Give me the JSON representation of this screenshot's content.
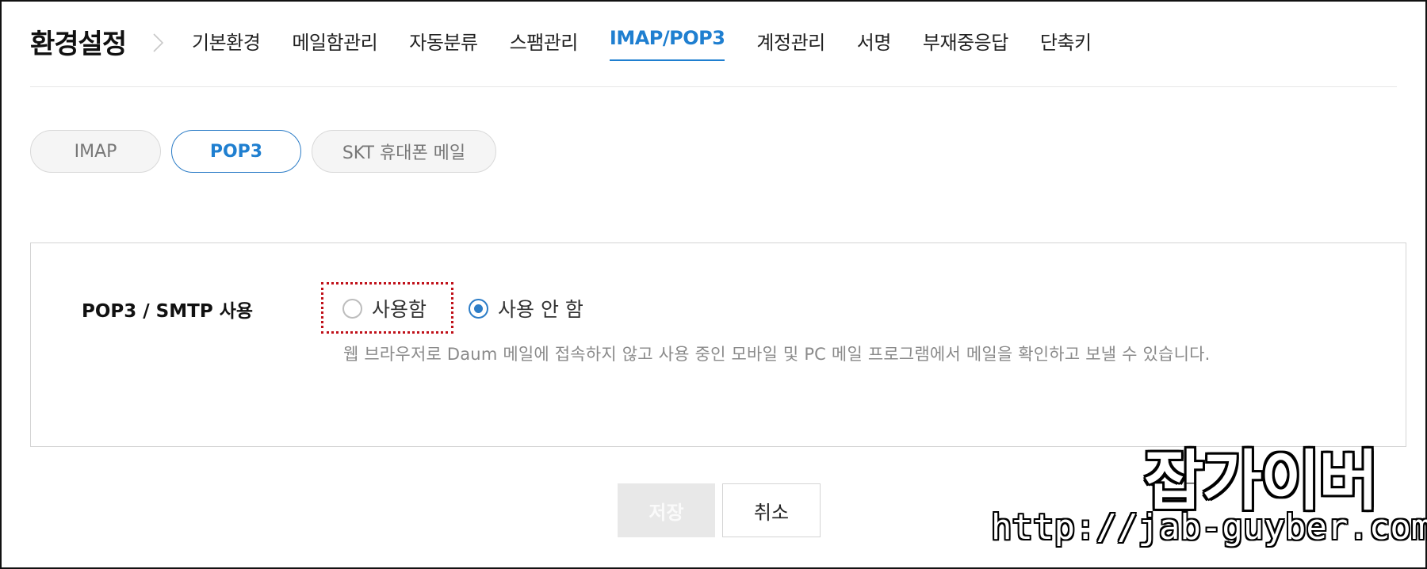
{
  "header": {
    "title": "환경설정",
    "menu": [
      {
        "label": "기본환경",
        "active": false
      },
      {
        "label": "메일함관리",
        "active": false
      },
      {
        "label": "자동분류",
        "active": false
      },
      {
        "label": "스팸관리",
        "active": false
      },
      {
        "label": "IMAP/POP3",
        "active": true
      },
      {
        "label": "계정관리",
        "active": false
      },
      {
        "label": "서명",
        "active": false
      },
      {
        "label": "부재중응답",
        "active": false
      },
      {
        "label": "단축키",
        "active": false
      }
    ]
  },
  "subtabs": [
    {
      "label": "IMAP",
      "active": false
    },
    {
      "label": "POP3",
      "active": true
    },
    {
      "label": "SKT 휴대폰 메일",
      "active": false
    }
  ],
  "setting": {
    "label": "POP3 / SMTP 사용",
    "options": [
      {
        "label": "사용함",
        "checked": false
      },
      {
        "label": "사용 안 함",
        "checked": true
      }
    ],
    "description": "웹 브라우저로 Daum 메일에 접속하지 않고 사용 중인 모바일 및 PC 메일 프로그램에서 메일을 확인하고 보낼 수 있습니다."
  },
  "actions": {
    "save_label": "저장",
    "cancel_label": "취소"
  },
  "watermark": {
    "title": "잡가이버",
    "url": "http://jab-guyber.com"
  },
  "colors": {
    "accent": "#1f7fd0",
    "highlight": "#c0111a",
    "disabled_bg": "#e8e8e8"
  },
  "icons": {
    "title_separator": "chevron-right-icon"
  }
}
